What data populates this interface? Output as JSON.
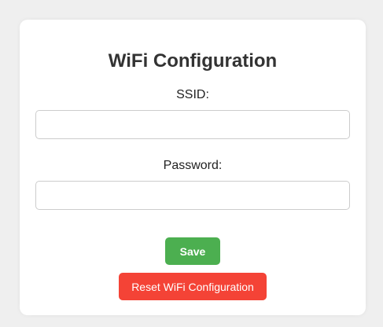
{
  "form": {
    "title": "WiFi Configuration",
    "ssid_label": "SSID:",
    "ssid_value": "",
    "password_label": "Password:",
    "password_value": "",
    "save_label": "Save",
    "reset_label": "Reset WiFi Configuration"
  },
  "colors": {
    "page_background": "#efefef",
    "card_background": "#ffffff",
    "save_button": "#4caf50",
    "reset_button": "#f44336",
    "title_text": "#333333"
  }
}
